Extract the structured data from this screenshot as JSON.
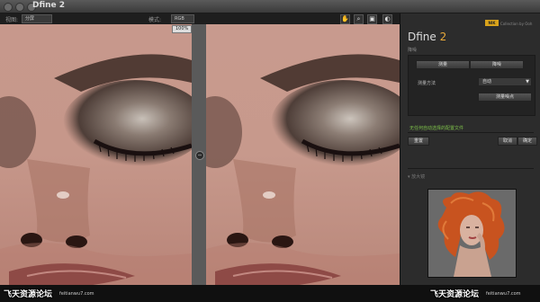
{
  "window": {
    "title": "Dfine 2"
  },
  "toolbar": {
    "view_label": "视图:",
    "layout_label": "分屏",
    "mode_label": "模式:",
    "mode_value": "RGB",
    "zoom_value": "100%"
  },
  "panel": {
    "brand_badge": "NIK",
    "brand_text": "Collection by Ooh",
    "title_word": "Dfine",
    "title_num": "2",
    "subtitle": "降噪",
    "measure_label": "测量",
    "reduce_label": "降噪",
    "method_label": "测量方法",
    "method_value": "自动",
    "measure_button": "测量噪点",
    "profile_note": "无任何自动选择的配置文件",
    "reset_label": "重置",
    "cancel_label": "取消",
    "ok_label": "确定",
    "loupe_label": "放大镜"
  },
  "watermark": {
    "left_text": "飞天资源论坛",
    "left_url": "feitianwu7.com",
    "right_text": "飞天资源论坛",
    "right_url": "feitianwu7.com"
  },
  "colors": {
    "accent": "#e8a93a",
    "status_green": "#7ec24a",
    "brand_badge": "#d9a31b"
  }
}
